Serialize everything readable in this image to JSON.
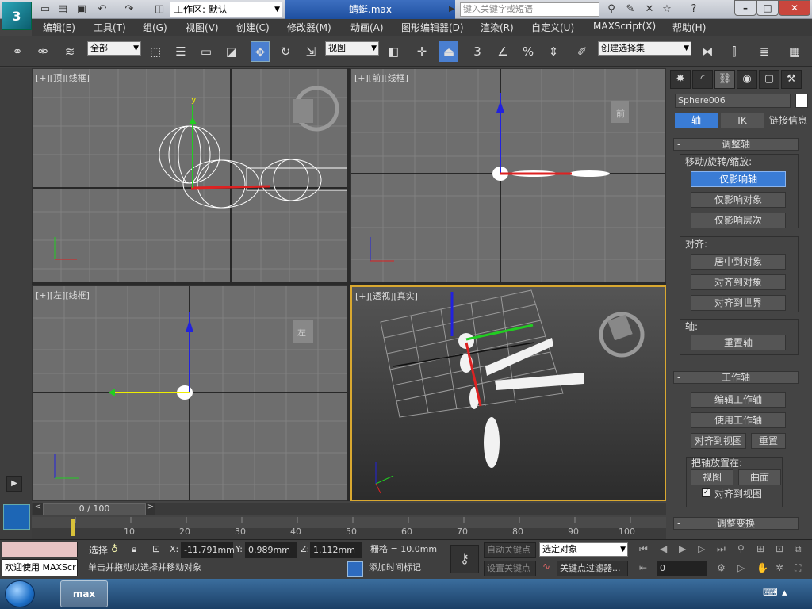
{
  "titlebar": {
    "workspace_label": "工作区: 默认",
    "title": "蜻蜓.max",
    "search_placeholder": "键入关键字或短语"
  },
  "menu": [
    "编辑(E)",
    "工具(T)",
    "组(G)",
    "视图(V)",
    "创建(C)",
    "修改器(M)",
    "动画(A)",
    "图形编辑器(D)",
    "渲染(R)",
    "自定义(U)",
    "MAXScript(X)",
    "帮助(H)"
  ],
  "toolbar": {
    "filter": "全部",
    "refcoord": "视图",
    "named_selection": "创建选择集",
    "snap": "3"
  },
  "viewports": {
    "top": "[+][顶][线框]",
    "front": "[+][前][线框]",
    "left": "[+][左][线框]",
    "persp": "[+][透视][真实]",
    "cube_front": "前",
    "cube_left": "左"
  },
  "panel": {
    "object_name": "Sphere006",
    "tabs": [
      "轴",
      "IK",
      "链接信息"
    ],
    "rollout_adjust": "调整轴",
    "group_move": "移动/旋转/缩放:",
    "btn_pivot_only": "仅影响轴",
    "btn_object_only": "仅影响对象",
    "btn_hierarchy_only": "仅影响层次",
    "group_align": "对齐:",
    "btn_center": "居中到对象",
    "btn_align_obj": "对齐到对象",
    "btn_align_world": "对齐到世界",
    "group_pivot": "轴:",
    "btn_reset_pivot": "重置轴",
    "rollout_workpivot": "工作轴",
    "btn_edit_wp": "编辑工作轴",
    "btn_use_wp": "使用工作轴",
    "btn_align_view": "对齐到视图",
    "btn_reset": "重置",
    "group_place": "把轴放置在:",
    "btn_view": "视图",
    "btn_surface": "曲面",
    "chk_align_view": "对齐到视图",
    "rollout_transform": "调整变换"
  },
  "timeline": {
    "frame": "0 / 100",
    "ticks": [
      "10",
      "20",
      "30",
      "40",
      "50",
      "60",
      "70",
      "80",
      "90",
      "100"
    ]
  },
  "status": {
    "welcome": "欢迎使用 MAXScr",
    "sel_label": "选择",
    "x_value": "-11.791mm",
    "y_value": "0.989mm",
    "z_value": "1.112mm",
    "grid": "栅格 = 10.0mm",
    "autokey": "自动关键点",
    "setkey": "设置关键点",
    "key_mode": "选定对象",
    "key_filter": "关键点过滤器...",
    "prompt": "单击并拖动以选择并移动对象",
    "add_tag": "添加时间标记",
    "frame_field": "0"
  },
  "taskbar": {
    "app": "max"
  }
}
